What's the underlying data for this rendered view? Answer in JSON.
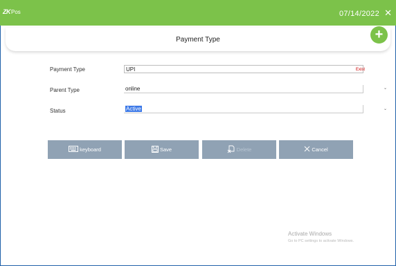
{
  "topbar": {
    "logo_zk": "ZK",
    "logo_pos": "Pos",
    "date": "07/14/2022",
    "close_glyph": "✕",
    "color": "#7cc24a"
  },
  "header": {
    "title": "Payment Type",
    "add_glyph": "+"
  },
  "form": {
    "payment_type": {
      "label": "Payment Type",
      "value": "UPI",
      "error": "Exist"
    },
    "parent_type": {
      "label": "Parent Type",
      "value": "online",
      "chevron": "⌄"
    },
    "status": {
      "label": "Status",
      "value": "Active",
      "chevron": "⌄"
    }
  },
  "buttons": {
    "keyboard": {
      "label": "keyboard",
      "icon": "keyboard-icon"
    },
    "save": {
      "label": "Save",
      "icon": "save-icon"
    },
    "delete": {
      "label": "Delete",
      "icon": "delete-icon"
    },
    "cancel": {
      "label": "Cancel",
      "icon": "close-icon"
    }
  },
  "watermark": {
    "line1": "Activate Windows",
    "line2": "Go to PC settings to activate Windows."
  }
}
